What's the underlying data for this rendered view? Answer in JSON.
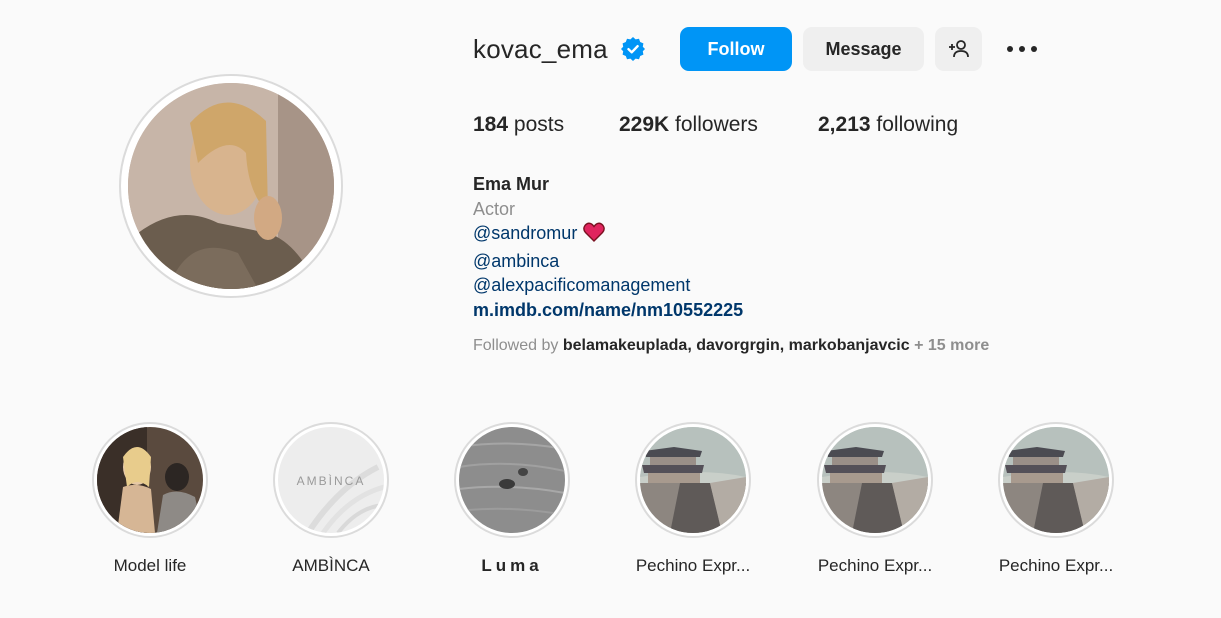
{
  "profile": {
    "username": "kovac_ema",
    "verified_icon": "verified-badge-icon",
    "accent_color": "#0095f6"
  },
  "actions": {
    "follow_label": "Follow",
    "message_label": "Message"
  },
  "stats": {
    "posts_count": "184",
    "posts_label": "posts",
    "followers_count": "229K",
    "followers_label": "followers",
    "following_count": "2,213",
    "following_label": "following"
  },
  "bio": {
    "name": "Ema Mur",
    "category": "Actor",
    "mention1": "@sandromur",
    "mention2": "@ambinca",
    "mention3": "@alexpacificomanagement",
    "website": "m.imdb.com/name/nm10552225"
  },
  "followed_by": {
    "prefix": "Followed by",
    "names": "belamakeuplada, davorgrgin, markobanjavcic",
    "more": "+ 15 more"
  },
  "highlights": [
    {
      "label": "Model life"
    },
    {
      "label": "AMBÌNCA"
    },
    {
      "label": "Luma"
    },
    {
      "label": "Pechino Expr..."
    },
    {
      "label": "Pechino Expr..."
    },
    {
      "label": "Pechino Expr..."
    }
  ],
  "ambinca_cover_text": "AMBÌNCA"
}
